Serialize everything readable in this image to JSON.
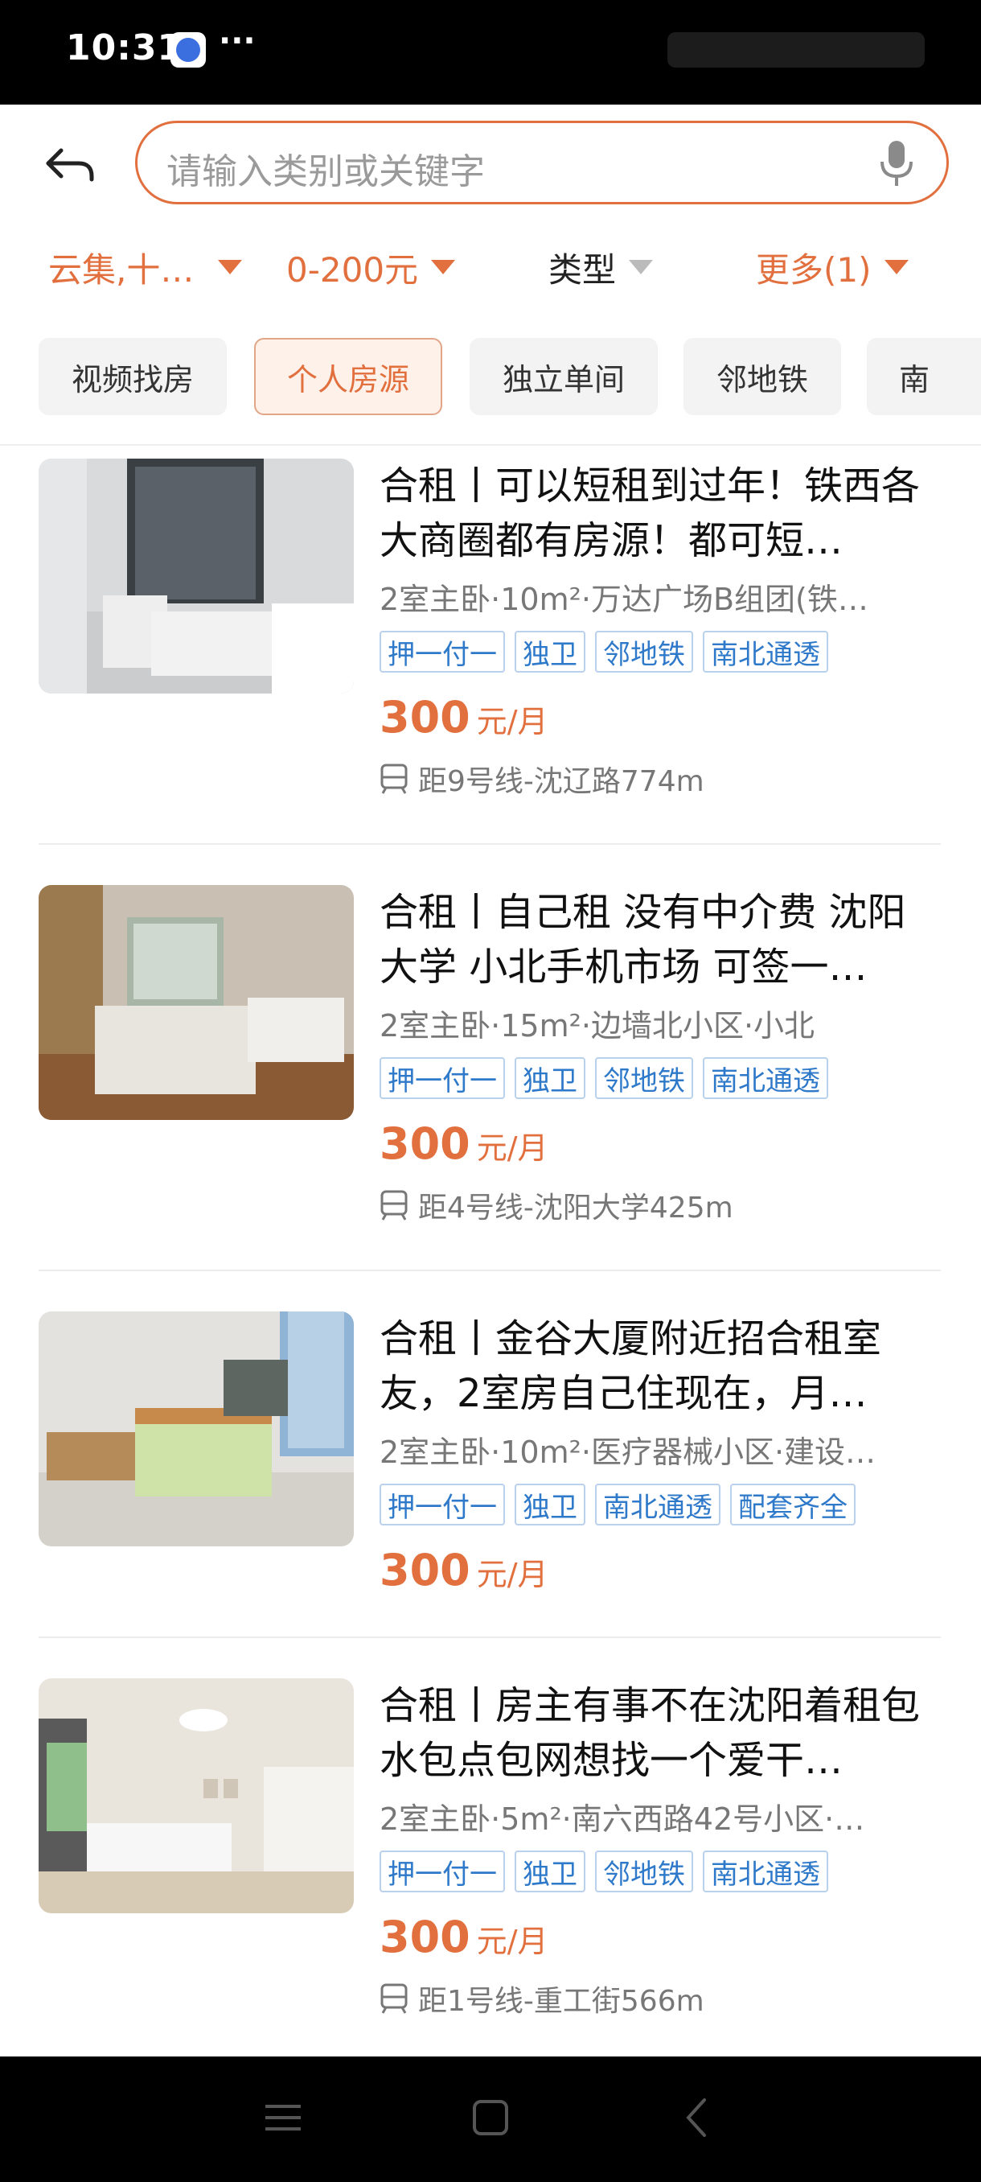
{
  "status_bar": {
    "time": "10:31",
    "more": "···"
  },
  "search": {
    "placeholder": "请输入类别或关键字"
  },
  "filters": [
    {
      "label": "云集,十…"
    },
    {
      "label": "0-200元"
    },
    {
      "label": "类型"
    },
    {
      "label": "更多(1)"
    }
  ],
  "chips": [
    "视频找房",
    "个人房源",
    "独立单间",
    "邻地铁",
    "南"
  ],
  "listings": [
    {
      "title": "合租丨可以短租到过年！铁西各大商圈都有房源！都可短…",
      "meta": "2室主卧·10m²·万达广场B组团(铁…",
      "tags": [
        "押一付一",
        "独卫",
        "邻地铁",
        "南北通透"
      ],
      "price": "300",
      "unit": "元/月",
      "subway": "距9号线-沈辽路774m"
    },
    {
      "title": "合租丨自己租 没有中介费 沈阳大学 小北手机市场 可签一…",
      "meta": "2室主卧·15m²·边墙北小区·小北",
      "tags": [
        "押一付一",
        "独卫",
        "邻地铁",
        "南北通透"
      ],
      "price": "300",
      "unit": "元/月",
      "subway": "距4号线-沈阳大学425m"
    },
    {
      "title": "合租丨金谷大厦附近招合租室友，2室房自己住现在，月…",
      "meta": "2室主卧·10m²·医疗器械小区·建设…",
      "tags": [
        "押一付一",
        "独卫",
        "南北通透",
        "配套齐全"
      ],
      "price": "300",
      "unit": "元/月",
      "subway": ""
    },
    {
      "title": "合租丨房主有事不在沈阳着租包水包点包网想找一个爱干…",
      "meta": "2室主卧·5m²·南六西路42号小区·…",
      "tags": [
        "押一付一",
        "独卫",
        "邻地铁",
        "南北通透"
      ],
      "price": "300",
      "unit": "元/月",
      "subway": "距1号线-重工街566m"
    }
  ],
  "colors": {
    "accent": "#e2703f",
    "tag_blue": "#2e79c9"
  }
}
